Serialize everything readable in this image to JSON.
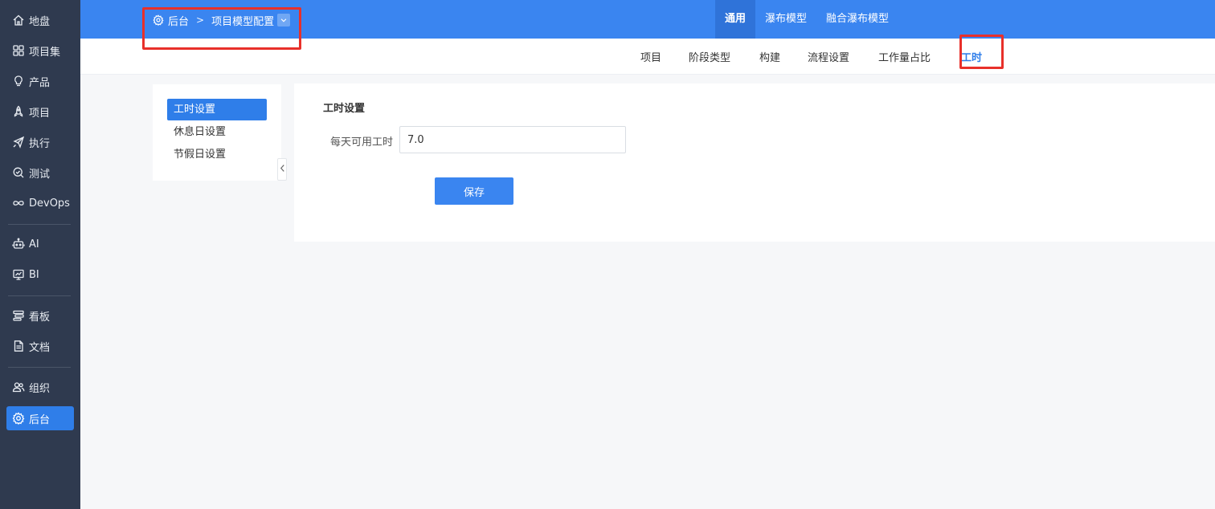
{
  "sidebar": {
    "items": [
      {
        "label": "地盘",
        "icon": "home-icon"
      },
      {
        "label": "项目集",
        "icon": "grid-icon"
      },
      {
        "label": "产品",
        "icon": "lightbulb-icon"
      },
      {
        "label": "项目",
        "icon": "rocket-icon"
      },
      {
        "label": "执行",
        "icon": "send-icon"
      },
      {
        "label": "测试",
        "icon": "search-check-icon"
      },
      {
        "label": "DevOps",
        "icon": "infinity-icon"
      },
      {
        "label": "AI",
        "icon": "robot-icon"
      },
      {
        "label": "BI",
        "icon": "presentation-chart-icon"
      },
      {
        "label": "看板",
        "icon": "board-icon"
      },
      {
        "label": "文档",
        "icon": "document-icon"
      },
      {
        "label": "组织",
        "icon": "users-icon"
      },
      {
        "label": "后台",
        "icon": "gear-icon",
        "active": true
      }
    ]
  },
  "header": {
    "breadcrumb": {
      "root": "后台",
      "separator": ">",
      "current": "项目模型配置"
    },
    "tabs": [
      {
        "label": "通用",
        "active": true
      },
      {
        "label": "瀑布模型"
      },
      {
        "label": "融合瀑布模型"
      }
    ]
  },
  "subnav": {
    "tabs": [
      {
        "label": "项目"
      },
      {
        "label": "阶段类型"
      },
      {
        "label": "构建"
      },
      {
        "label": "流程设置"
      },
      {
        "label": "工作量占比"
      },
      {
        "label": "工时",
        "active": true
      }
    ]
  },
  "side_panel": {
    "items": [
      {
        "label": "工时设置",
        "active": true
      },
      {
        "label": "休息日设置"
      },
      {
        "label": "节假日设置"
      }
    ]
  },
  "form": {
    "title": "工时设置",
    "hours_label": "每天可用工时",
    "hours_value": "7.0",
    "save_label": "保存"
  },
  "colors": {
    "accent": "#3a85f0",
    "sidebar_bg": "#2f3a4f",
    "highlight": "#e8302a"
  }
}
